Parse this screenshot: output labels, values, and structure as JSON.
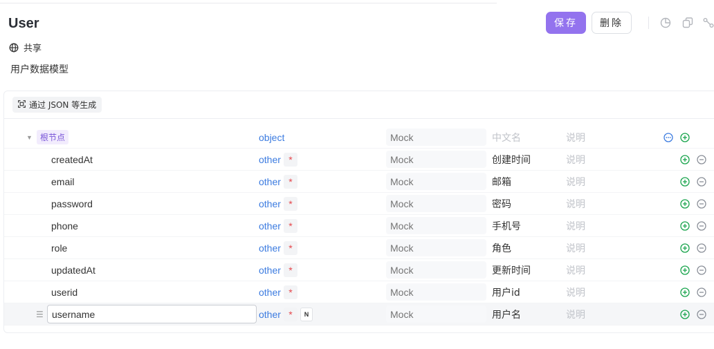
{
  "header": {
    "title": "User",
    "share_label": "共享",
    "description": "用户数据模型",
    "save_label": "保存",
    "delete_label": "删除"
  },
  "toolbar": {
    "icons": [
      "chart-icon",
      "copy-icon",
      "connect-icon"
    ]
  },
  "schema": {
    "generate_label": "通过 JSON 等生成",
    "mock_placeholder": "Mock",
    "cn_placeholder": "中文名",
    "note_placeholder": "说明",
    "root": {
      "label": "根节点",
      "type": "object"
    },
    "fields": [
      {
        "name": "createdAt",
        "type": "other",
        "required": "*",
        "cn": "创建时间"
      },
      {
        "name": "email",
        "type": "other",
        "required": "*",
        "cn": "邮箱"
      },
      {
        "name": "password",
        "type": "other",
        "required": "*",
        "cn": "密码"
      },
      {
        "name": "phone",
        "type": "other",
        "required": "*",
        "cn": "手机号"
      },
      {
        "name": "role",
        "type": "other",
        "required": "*",
        "cn": "角色"
      },
      {
        "name": "updatedAt",
        "type": "other",
        "required": "*",
        "cn": "更新时间"
      },
      {
        "name": "userid",
        "type": "other",
        "required": "*",
        "cn": "用户id"
      },
      {
        "name": "username",
        "type": "other",
        "required": "*",
        "nullable_badge": "N",
        "cn": "用户名"
      }
    ]
  },
  "colors": {
    "accent": "#9373ee",
    "type_blue": "#3b7be0",
    "required_red": "#e5484d",
    "add_green": "#16a34a"
  }
}
